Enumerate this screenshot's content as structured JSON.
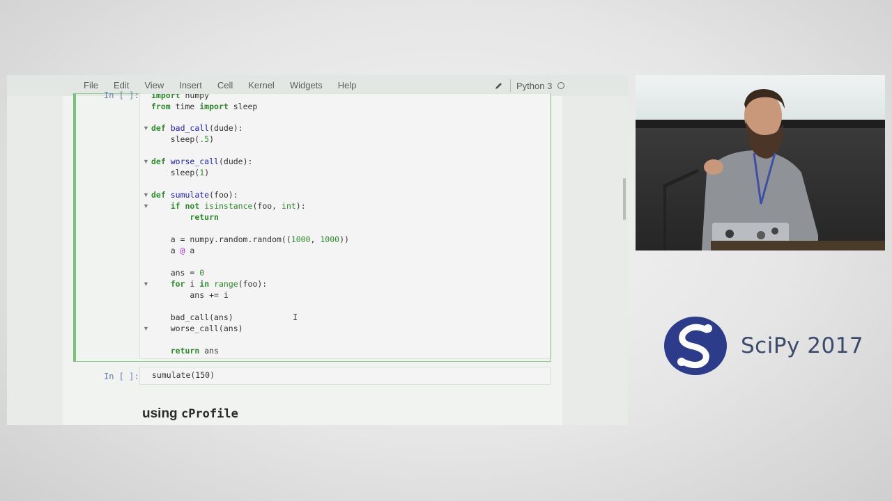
{
  "menu": {
    "items": [
      "File",
      "Edit",
      "View",
      "Insert",
      "Cell",
      "Kernel",
      "Widgets",
      "Help"
    ],
    "kernel_name": "Python 3"
  },
  "cells": {
    "cell1_prompt": "In [ ]:",
    "cell2_prompt": "In [ ]:",
    "cell2_code": "sumulate(150)"
  },
  "code_lines": [
    {
      "text": "import numpy"
    },
    {
      "text": "from time import sleep"
    },
    {
      "text": ""
    },
    {
      "text": "def bad_call(dude):"
    },
    {
      "text": "    sleep(.5)"
    },
    {
      "text": ""
    },
    {
      "text": "def worse_call(dude):"
    },
    {
      "text": "    sleep(1)"
    },
    {
      "text": ""
    },
    {
      "text": "def sumulate(foo):"
    },
    {
      "text": "    if not isinstance(foo, int):"
    },
    {
      "text": "        return"
    },
    {
      "text": ""
    },
    {
      "text": "    a = numpy.random.random((1000, 1000))"
    },
    {
      "text": "    a @ a"
    },
    {
      "text": ""
    },
    {
      "text": "    ans = 0"
    },
    {
      "text": "    for i in range(foo):"
    },
    {
      "text": "        ans += i"
    },
    {
      "text": ""
    },
    {
      "text": "    bad_call(ans)"
    },
    {
      "text": "    worse_call(ans)"
    },
    {
      "text": ""
    },
    {
      "text": "    return ans"
    }
  ],
  "markdown": {
    "heading_prefix": "using ",
    "heading_code": "cProfile"
  },
  "conference": {
    "title": "SciPy 2017"
  },
  "colors": {
    "selected_cell_border": "#79c379",
    "logo_blue": "#2c3b8a",
    "prompt_blue": "#6a7bb8"
  },
  "icons": [
    "pencil-icon",
    "kernel-status-icon",
    "fold-arrow-icon",
    "text-cursor-icon",
    "scipy-logo-icon"
  ]
}
